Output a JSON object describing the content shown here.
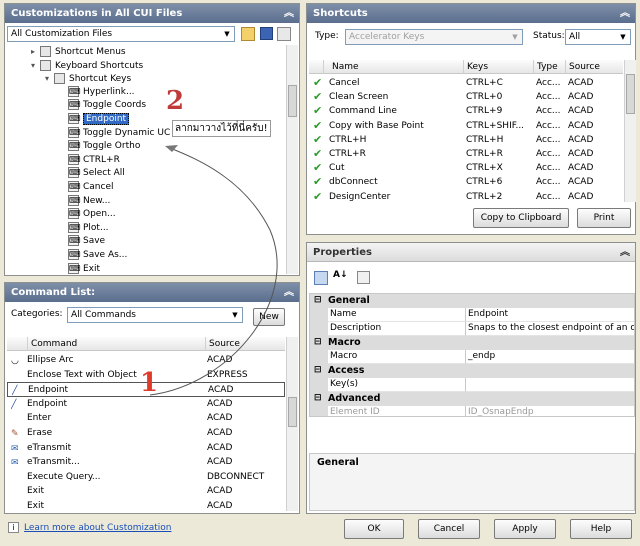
{
  "cui": {
    "title": "Customizations in All CUI Files",
    "file_combo": "All Customization Files",
    "tree": [
      {
        "label": "Shortcut Menus",
        "indent": 0,
        "expander": "+",
        "icon": "folder"
      },
      {
        "label": "Keyboard Shortcuts",
        "indent": 0,
        "expander": "-",
        "icon": "keyboard"
      },
      {
        "label": "Shortcut Keys",
        "indent": 1,
        "expander": "-",
        "icon": "keyboard"
      },
      {
        "label": "Hyperlink...",
        "indent": 2,
        "icon": "key"
      },
      {
        "label": "Toggle Coords",
        "indent": 2,
        "icon": "key"
      },
      {
        "label": "Endpoint",
        "indent": 2,
        "icon": "key",
        "selected": true
      },
      {
        "label": "Toggle Dynamic UC",
        "indent": 2,
        "icon": "key"
      },
      {
        "label": "Toggle Ortho",
        "indent": 2,
        "icon": "key"
      },
      {
        "label": "CTRL+R",
        "indent": 2,
        "icon": "key"
      },
      {
        "label": "Select All",
        "indent": 2,
        "icon": "key"
      },
      {
        "label": "Cancel",
        "indent": 2,
        "icon": "key"
      },
      {
        "label": "New...",
        "indent": 2,
        "icon": "key"
      },
      {
        "label": "Open...",
        "indent": 2,
        "icon": "key"
      },
      {
        "label": "Plot...",
        "indent": 2,
        "icon": "key"
      },
      {
        "label": "Save",
        "indent": 2,
        "icon": "key"
      },
      {
        "label": "Save As...",
        "indent": 2,
        "icon": "key"
      },
      {
        "label": "Exit",
        "indent": 2,
        "icon": "key"
      }
    ]
  },
  "command_list": {
    "title": "Command List:",
    "categories_label": "Categories:",
    "categories_value": "All Commands",
    "new_button": "New",
    "columns": [
      "Command",
      "Source"
    ],
    "rows": [
      {
        "icon": "arc",
        "command": "Ellipse Arc",
        "source": "ACAD"
      },
      {
        "icon": "",
        "command": "Enclose Text with Object",
        "source": "EXPRESS"
      },
      {
        "icon": "line",
        "command": "Endpoint",
        "source": "ACAD",
        "boxed": true
      },
      {
        "icon": "line",
        "command": "Endpoint",
        "source": "ACAD"
      },
      {
        "icon": "",
        "command": "Enter",
        "source": "ACAD"
      },
      {
        "icon": "eraser",
        "command": "Erase",
        "source": "ACAD"
      },
      {
        "icon": "transmit",
        "command": "eTransmit",
        "source": "ACAD"
      },
      {
        "icon": "transmit",
        "command": "eTransmit...",
        "source": "ACAD"
      },
      {
        "icon": "",
        "command": "Execute Query...",
        "source": "DBCONNECT"
      },
      {
        "icon": "",
        "command": "Exit",
        "source": "ACAD"
      },
      {
        "icon": "",
        "command": "Exit",
        "source": "ACAD"
      }
    ]
  },
  "shortcuts": {
    "title": "Shortcuts",
    "type_label": "Type:",
    "type_value": "Accelerator Keys",
    "status_label": "Status:",
    "status_value": "All",
    "columns": [
      "Name",
      "Keys",
      "Type",
      "Source"
    ],
    "rows": [
      {
        "name": "Cancel",
        "keys": "CTRL+C",
        "type": "Acc...",
        "source": "ACAD"
      },
      {
        "name": "Clean Screen",
        "keys": "CTRL+0",
        "type": "Acc...",
        "source": "ACAD"
      },
      {
        "name": "Command Line",
        "keys": "CTRL+9",
        "type": "Acc...",
        "source": "ACAD"
      },
      {
        "name": "Copy with Base Point",
        "keys": "CTRL+SHIF...",
        "type": "Acc...",
        "source": "ACAD"
      },
      {
        "name": "CTRL+H",
        "keys": "CTRL+H",
        "type": "Acc...",
        "source": "ACAD"
      },
      {
        "name": "CTRL+R",
        "keys": "CTRL+R",
        "type": "Acc...",
        "source": "ACAD"
      },
      {
        "name": "Cut",
        "keys": "CTRL+X",
        "type": "Acc...",
        "source": "ACAD"
      },
      {
        "name": "dbConnect",
        "keys": "CTRL+6",
        "type": "Acc...",
        "source": "ACAD"
      },
      {
        "name": "DesignCenter",
        "keys": "CTRL+2",
        "type": "Acc...",
        "source": "ACAD"
      }
    ],
    "copy_button": "Copy to Clipboard",
    "print_button": "Print"
  },
  "properties": {
    "title": "Properties",
    "sections": [
      {
        "category": "General",
        "items": [
          {
            "name": "Name",
            "value": "Endpoint"
          },
          {
            "name": "Description",
            "value": "Snaps to the closest endpoint of an object"
          }
        ]
      },
      {
        "category": "Macro",
        "items": [
          {
            "name": "Macro",
            "value": "_endp"
          }
        ]
      },
      {
        "category": "Access",
        "items": [
          {
            "name": "Key(s)",
            "value": ""
          }
        ]
      },
      {
        "category": "Advanced",
        "items": [
          {
            "name": "Element ID",
            "value": "ID_OsnapEndp",
            "disabled": true
          }
        ]
      }
    ],
    "help_title": "General"
  },
  "annotations": {
    "num1": "1",
    "num2": "2",
    "thai_note": "ลากมาวางไว้ที่นี่ครับ!",
    "colors": {
      "num1": "#e03a2a",
      "num2": "#c03a3a"
    }
  },
  "footer": {
    "learn_link": "Learn more about Customization",
    "ok": "OK",
    "cancel": "Cancel",
    "apply": "Apply",
    "help": "Help"
  }
}
